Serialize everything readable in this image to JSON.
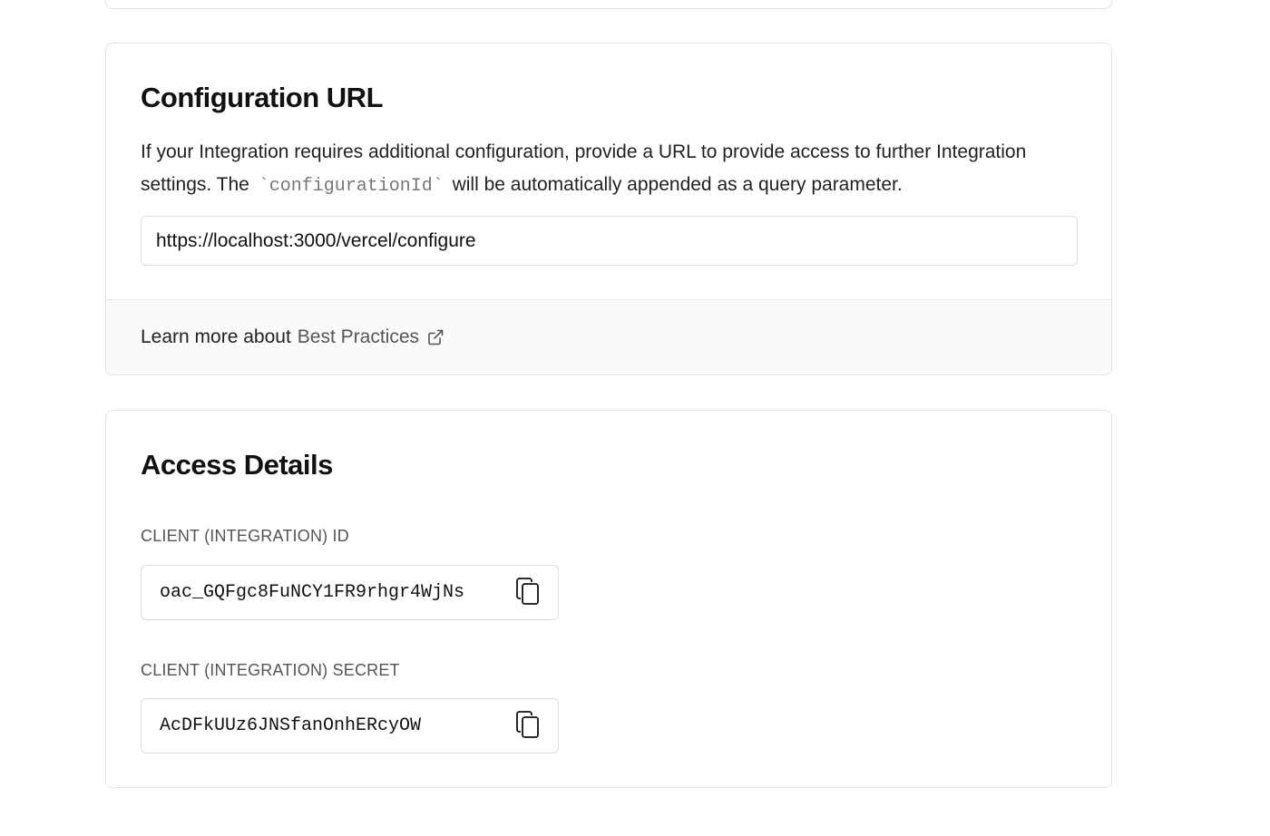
{
  "configuration_url": {
    "title": "Configuration URL",
    "description_part1": "If your Integration requires additional configuration, provide a URL to provide access to further Integration settings. The",
    "description_code": "`configurationId`",
    "description_part2": "will be automatically appended as a query parameter.",
    "url_value": "https://localhost:3000/vercel/configure",
    "footer_prefix": "Learn more about",
    "footer_link": "Best Practices",
    "footer_link_icon": "external-link-icon"
  },
  "access_details": {
    "title": "Access Details",
    "client_id_label": "CLIENT (INTEGRATION) ID",
    "client_id_value": "oac_GQFgc8FuNCY1FR9rhgr4WjNs",
    "client_secret_label": "CLIENT (INTEGRATION) SECRET",
    "client_secret_value": "AcDFkUUz6JNSfanOnhERcyOW",
    "copy_icon": "copy-icon"
  },
  "colors": {
    "border": "#e3e3e3",
    "footer_bg": "#fafafa",
    "muted_text": "#555555"
  }
}
